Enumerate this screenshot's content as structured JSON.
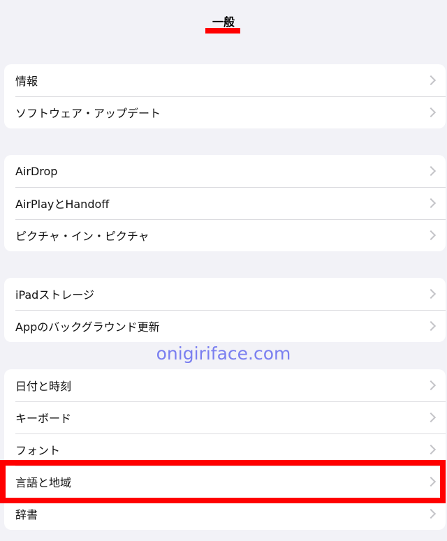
{
  "header": {
    "title": "一般"
  },
  "groups": [
    {
      "items": [
        {
          "label": "情報"
        },
        {
          "label": "ソフトウェア・アップデート"
        }
      ]
    },
    {
      "items": [
        {
          "label": "AirDrop"
        },
        {
          "label": "AirPlayとHandoff"
        },
        {
          "label": "ピクチャ・イン・ピクチャ"
        }
      ]
    },
    {
      "items": [
        {
          "label": "iPadストレージ"
        },
        {
          "label": "Appのバックグラウンド更新"
        }
      ]
    },
    {
      "items": [
        {
          "label": "日付と時刻"
        },
        {
          "label": "キーボード"
        },
        {
          "label": "フォント"
        },
        {
          "label": "言語と地域"
        },
        {
          "label": "辞書"
        }
      ]
    }
  ],
  "watermark": "onigiriface.com",
  "colors": {
    "highlight": "#ff0000",
    "background": "#f2f2f7",
    "watermark": "#7a7ff0"
  }
}
